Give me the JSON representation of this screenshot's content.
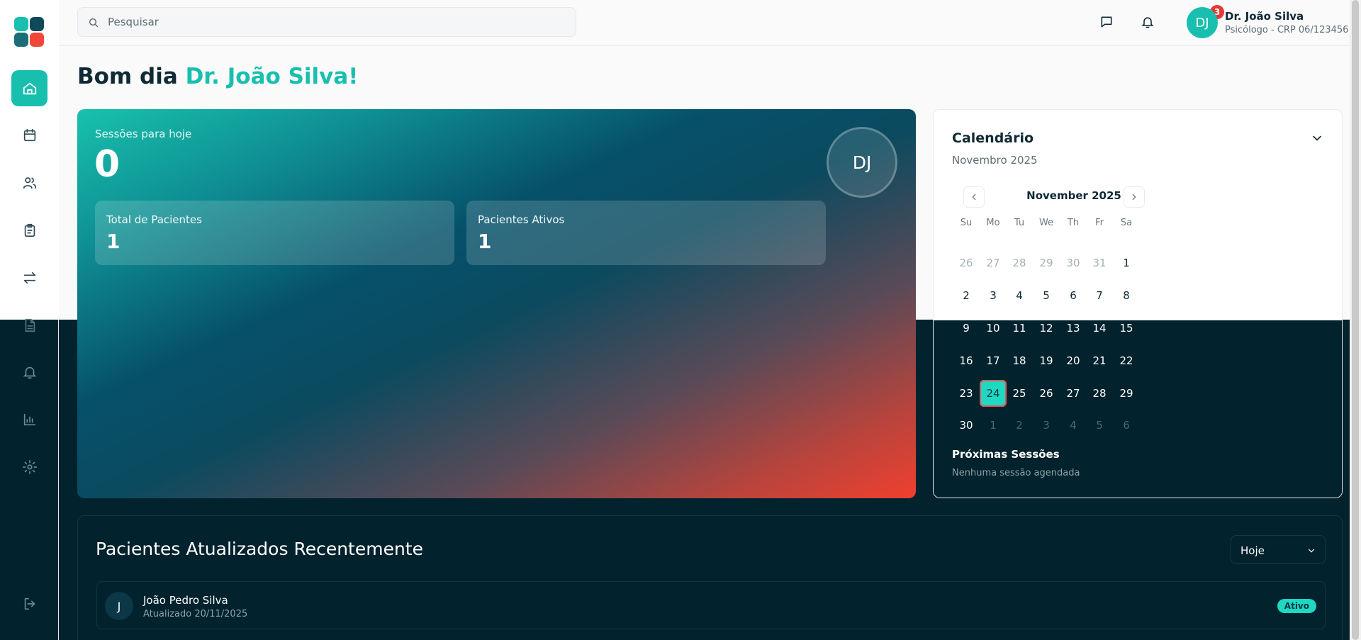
{
  "header": {
    "search_placeholder": "Pesquisar",
    "notification_count": "3",
    "user": {
      "initials": "DJ",
      "name": "Dr. João Silva",
      "role": "Psicólogo - CRP 06/123456"
    }
  },
  "sidebar": {
    "items": [
      {
        "icon": "home-icon",
        "active": true
      },
      {
        "icon": "calendar-icon",
        "active": false
      },
      {
        "icon": "users-icon",
        "active": false
      },
      {
        "icon": "clipboard-icon",
        "active": false
      },
      {
        "icon": "transfer-icon",
        "active": false
      },
      {
        "icon": "document-icon",
        "active": false
      },
      {
        "icon": "bell-icon",
        "active": false
      },
      {
        "icon": "bar-chart-icon",
        "active": false
      },
      {
        "icon": "settings-icon",
        "active": false
      },
      {
        "icon": "logout-icon",
        "active": false
      }
    ]
  },
  "greeting": {
    "prefix": "Bom dia ",
    "name": "Dr. João Silva!"
  },
  "hero": {
    "sessions_label": "Sessões para hoje",
    "sessions_value": "0",
    "avatar_initials": "DJ",
    "stats": [
      {
        "label": "Total de Pacientes",
        "value": "1"
      },
      {
        "label": "Pacientes Ativos",
        "value": "1"
      }
    ]
  },
  "calendar": {
    "title": "Calendário",
    "subtitle": "Novembro 2025",
    "month_label": "November 2025",
    "weekdays": [
      "Su",
      "Mo",
      "Tu",
      "We",
      "Th",
      "Fr",
      "Sa"
    ],
    "weeks": [
      [
        [
          "26",
          0
        ],
        [
          "27",
          0
        ],
        [
          "28",
          0
        ],
        [
          "29",
          0
        ],
        [
          "30",
          0
        ],
        [
          "31",
          0
        ],
        [
          "1",
          1
        ]
      ],
      [
        [
          "2",
          1
        ],
        [
          "3",
          1
        ],
        [
          "4",
          1
        ],
        [
          "5",
          1
        ],
        [
          "6",
          1
        ],
        [
          "7",
          1
        ],
        [
          "8",
          1
        ]
      ],
      [
        [
          "9",
          1
        ],
        [
          "10",
          1
        ],
        [
          "11",
          1
        ],
        [
          "12",
          1
        ],
        [
          "13",
          1
        ],
        [
          "14",
          1
        ],
        [
          "15",
          1
        ]
      ],
      [
        [
          "16",
          1
        ],
        [
          "17",
          1
        ],
        [
          "18",
          1
        ],
        [
          "19",
          1
        ],
        [
          "20",
          1
        ],
        [
          "21",
          1
        ],
        [
          "22",
          1
        ]
      ],
      [
        [
          "23",
          1
        ],
        [
          "24",
          1
        ],
        [
          "25",
          1
        ],
        [
          "26",
          1
        ],
        [
          "27",
          1
        ],
        [
          "28",
          1
        ],
        [
          "29",
          1
        ]
      ],
      [
        [
          "30",
          1
        ],
        [
          "1",
          0
        ],
        [
          "2",
          0
        ],
        [
          "3",
          0
        ],
        [
          "4",
          0
        ],
        [
          "5",
          0
        ],
        [
          "6",
          0
        ]
      ]
    ],
    "selected_day": "24",
    "next_sessions_title": "Próximas Sessões",
    "next_sessions_empty": "Nenhuma sessão agendada"
  },
  "recent": {
    "title": "Pacientes Atualizados Recentemente",
    "filter_value": "Hoje",
    "patients": [
      {
        "initial": "J",
        "name": "João Pedro Silva",
        "updated": "Atualizado 20/11/2025",
        "status": "Ativo"
      }
    ]
  },
  "colors": {
    "accent": "#19bfae",
    "dark": "#02222e",
    "danger": "#e53935"
  }
}
